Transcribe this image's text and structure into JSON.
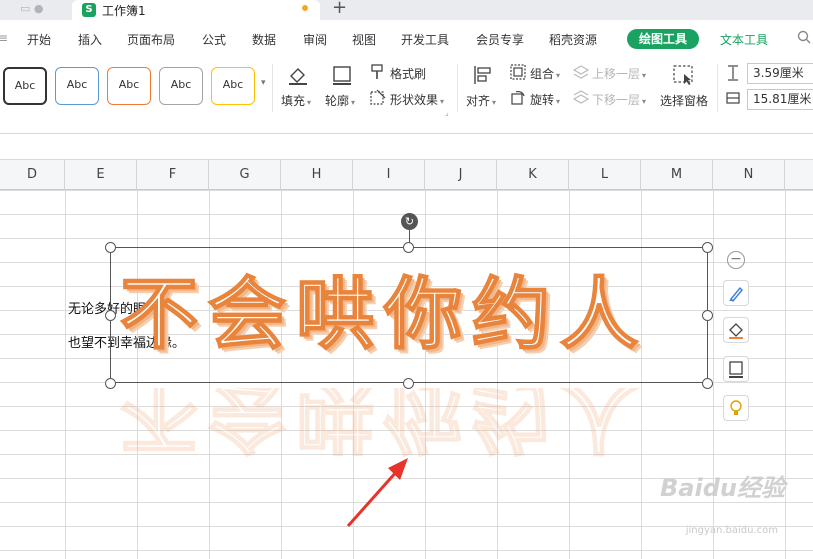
{
  "tabbar": {
    "doc_title": "工作簿1",
    "sheet_icon": "S"
  },
  "menu": {
    "items": [
      "开始",
      "插入",
      "页面布局",
      "公式",
      "数据",
      "审阅",
      "视图",
      "开发工具",
      "会员专享",
      "稻壳资源"
    ],
    "active_tab": "绘图工具",
    "text_tool": "文本工具"
  },
  "ribbon": {
    "style_presets": [
      "Abc",
      "Abc",
      "Abc",
      "Abc",
      "Abc"
    ],
    "style_colors": [
      "#333333",
      "#5b9bd5",
      "#ed7d31",
      "#a5a5a5",
      "#ffc000"
    ],
    "fill": "填充",
    "outline": "轮廓",
    "format_painter": "格式刷",
    "shape_effects": "形状效果",
    "align": "对齐",
    "group": "组合",
    "rotate": "旋转",
    "bring_forward": "上移一层",
    "send_backward": "下移一层",
    "selection_pane": "选择窗格",
    "height_value": "3.59厘米",
    "width_value": "15.81厘米"
  },
  "columns": [
    "D",
    "E",
    "F",
    "G",
    "H",
    "I",
    "J",
    "K",
    "L",
    "M",
    "N"
  ],
  "cells": {
    "line1": "无论多好的眼镜",
    "line2": "也望不到幸福边缘。"
  },
  "wordart": {
    "text": "不会哄你约人",
    "color": "#e8843c"
  },
  "watermark": {
    "brand": "Baidu经验",
    "url": "jingyan.baidu.com"
  }
}
